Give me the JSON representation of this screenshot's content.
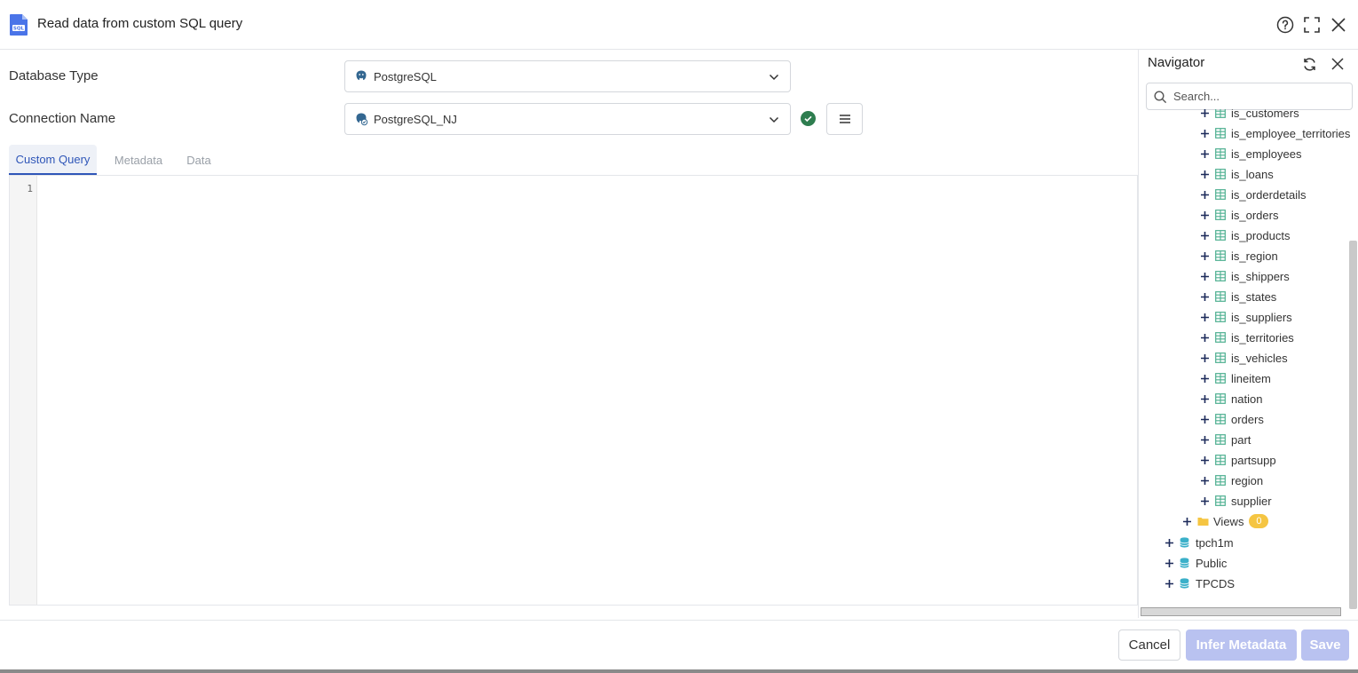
{
  "header": {
    "title": "Read data from custom SQL query",
    "file_icon_text": "SQL"
  },
  "form": {
    "database_type_label": "Database Type",
    "database_type_value": "PostgreSQL",
    "connection_name_label": "Connection Name",
    "connection_name_value": "PostgreSQL_NJ"
  },
  "tabs": [
    {
      "label": "Custom Query",
      "active": true
    },
    {
      "label": "Metadata",
      "active": false
    },
    {
      "label": "Data",
      "active": false
    }
  ],
  "editor": {
    "line_numbers": [
      "1"
    ]
  },
  "navigator": {
    "title": "Navigator",
    "search_placeholder": "Search...",
    "tables": [
      "is_customers",
      "is_employee_territories",
      "is_employees",
      "is_loans",
      "is_orderdetails",
      "is_orders",
      "is_products",
      "is_region",
      "is_shippers",
      "is_states",
      "is_suppliers",
      "is_territories",
      "is_vehicles",
      "lineitem",
      "nation",
      "orders",
      "part",
      "partsupp",
      "region",
      "supplier"
    ],
    "views_label": "Views",
    "views_count": "0",
    "schemas": [
      "tpch1m",
      "Public",
      "TPCDS"
    ]
  },
  "footer": {
    "cancel_label": "Cancel",
    "infer_label": "Infer Metadata",
    "save_label": "Save"
  },
  "colors": {
    "accent": "#2f56b8",
    "disabled_button": "#b9c2f0",
    "success": "#2e7d4f",
    "table_icon": "#4caf8f",
    "folder_icon": "#f5c542",
    "db_icon": "#3bb0c9",
    "badge": "#f5c542"
  }
}
